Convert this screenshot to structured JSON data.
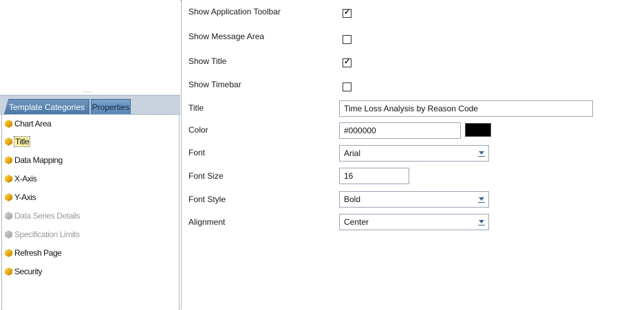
{
  "left_panel": {
    "grip": "......",
    "tabs": {
      "template_categories": "Template Categories",
      "properties": "Properties"
    },
    "items": [
      {
        "label": "Chart Area",
        "disabled": false,
        "selected": false
      },
      {
        "label": "Title",
        "disabled": false,
        "selected": true
      },
      {
        "label": "Data Mapping",
        "disabled": false,
        "selected": false
      },
      {
        "label": "X-Axis",
        "disabled": false,
        "selected": false
      },
      {
        "label": "Y-Axis",
        "disabled": false,
        "selected": false
      },
      {
        "label": "Data Series Details",
        "disabled": true,
        "selected": false
      },
      {
        "label": "Specification Limits",
        "disabled": true,
        "selected": false
      },
      {
        "label": "Refresh Page",
        "disabled": false,
        "selected": false
      },
      {
        "label": "Security",
        "disabled": false,
        "selected": false
      }
    ]
  },
  "properties": {
    "show_app_toolbar": {
      "label": "Show Application Toolbar",
      "checked": true
    },
    "show_message_area": {
      "label": "Show Message Area",
      "checked": false
    },
    "show_title": {
      "label": "Show Title",
      "checked": true
    },
    "show_timebar": {
      "label": "Show Timebar",
      "checked": false
    },
    "title": {
      "label": "Title",
      "value": "Time Loss Analysis by Reason Code"
    },
    "color": {
      "label": "Color",
      "value": "#000000",
      "swatch": "#000000"
    },
    "font": {
      "label": "Font",
      "value": "Arial"
    },
    "font_size": {
      "label": "Font Size",
      "value": "16"
    },
    "font_style": {
      "label": "Font Style",
      "value": "Bold"
    },
    "alignment": {
      "label": "Alignment",
      "value": "Center"
    },
    "check_glyph": "✓"
  },
  "colors": {
    "tab_active": "#4a78a8",
    "tabbar": "#c9d3df",
    "icon": "#e2a20a",
    "icon_disabled": "#9e9e9e",
    "select_arrow": "#3d6896"
  }
}
